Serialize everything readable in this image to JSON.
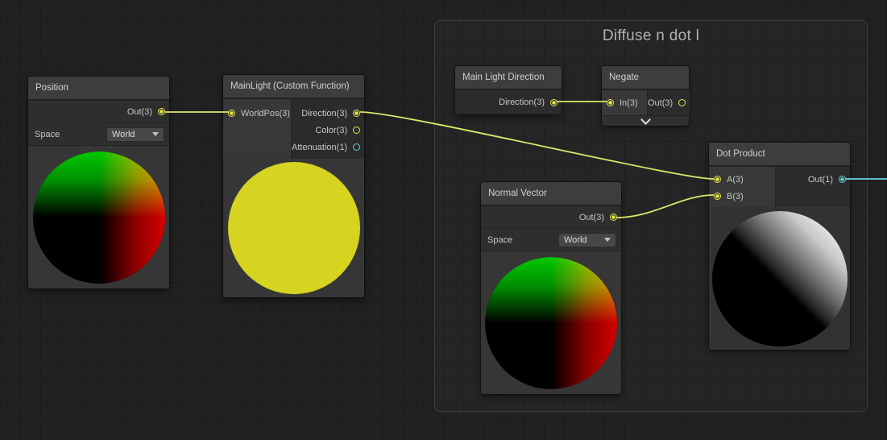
{
  "group": {
    "title": "Diffuse n dot l"
  },
  "nodes": {
    "position": {
      "title": "Position",
      "out_label": "Out(3)",
      "space_label": "Space",
      "space_value": "World"
    },
    "main_light": {
      "title": "MainLight (Custom Function)",
      "worldpos_label": "WorldPos(3)",
      "direction_label": "Direction(3)",
      "color_label": "Color(3)",
      "attenuation_label": "Attenuation(1)"
    },
    "main_light_direction": {
      "title": "Main Light Direction",
      "direction_label": "Direction(3)"
    },
    "negate": {
      "title": "Negate",
      "in_label": "In(3)",
      "out_label": "Out(3)"
    },
    "normal_vector": {
      "title": "Normal Vector",
      "out_label": "Out(3)",
      "space_label": "Space",
      "space_value": "World"
    },
    "dot_product": {
      "title": "Dot Product",
      "a_label": "A(3)",
      "b_label": "B(3)",
      "out_label": "Out(1)"
    }
  },
  "colors": {
    "vector3_port": "#e8e84a",
    "vector1_port": "#5fd3de",
    "wire_vector3": "#dde76a",
    "wire_vector1": "#6bd5dd",
    "preview_red": "#d40000",
    "preview_green": "#00c800",
    "preview_yellow": "#d6d321"
  }
}
